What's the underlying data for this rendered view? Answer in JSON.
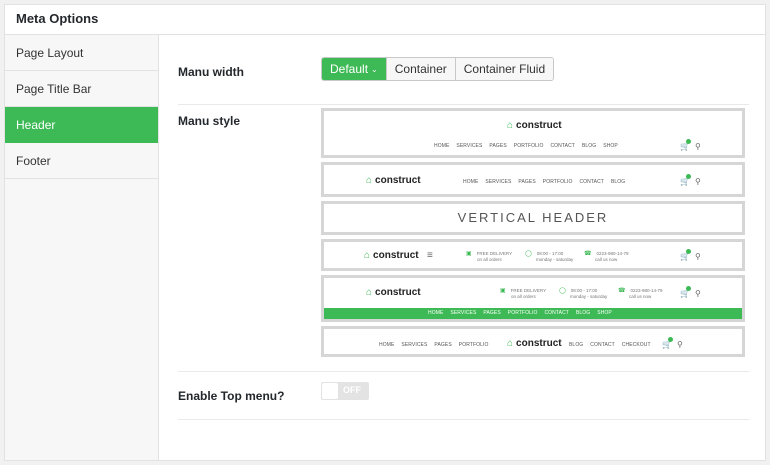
{
  "panel": {
    "title": "Meta Options"
  },
  "sidebar": {
    "items": [
      {
        "label": "Page Layout",
        "active": false
      },
      {
        "label": "Page Title Bar",
        "active": false
      },
      {
        "label": "Header",
        "active": true
      },
      {
        "label": "Footer",
        "active": false
      }
    ]
  },
  "menu_width": {
    "label": "Manu width",
    "options": [
      "Default",
      "Container",
      "Container Fluid"
    ],
    "selected": "Default"
  },
  "menu_style": {
    "label": "Manu style",
    "brand": "construct",
    "vertical_label": "VERTICAL HEADER",
    "menu_items": [
      "HOME",
      "SERVICES",
      "PAGES",
      "PORTFOLIO",
      "CONTACT",
      "BLOG",
      "SHOP"
    ],
    "centered_menu_left": [
      "HOME",
      "SERVICES",
      "PAGES",
      "PORTFOLIO"
    ],
    "centered_menu_right": [
      "BLOG",
      "CONTACT",
      "CHECKOUT"
    ],
    "info_items": [
      {
        "title": "FREE DELIVERY",
        "sub": "on all orders"
      },
      {
        "title": "08:00 - 17:00",
        "sub": "monday - saturday"
      },
      {
        "title": "0223-980-14-79",
        "sub": "call us now"
      }
    ]
  },
  "top_menu": {
    "label": "Enable Top menu?",
    "state": "OFF"
  },
  "colors": {
    "accent": "#3dba55",
    "border": "#d6d6d6"
  }
}
